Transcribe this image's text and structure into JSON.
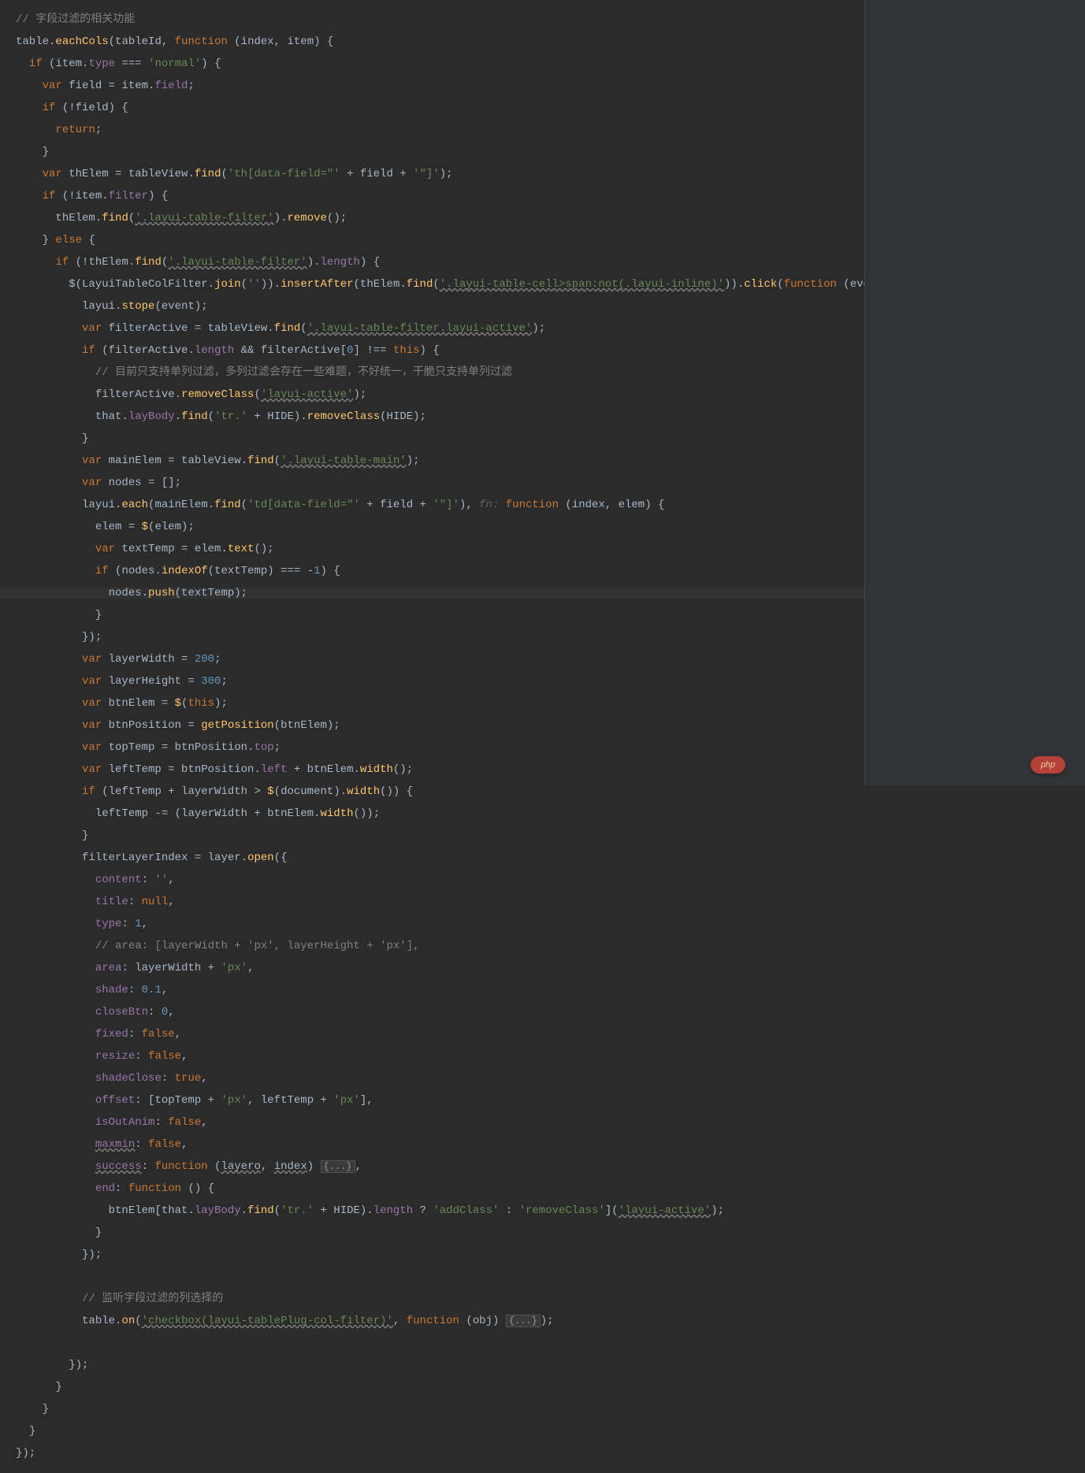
{
  "lines": {
    "l1_comment": "// 字段过滤的相关功能",
    "l2_a": "table.",
    "l2_b": "eachCols",
    "l2_c": "(tableId, ",
    "l2_d": "function",
    "l2_e": " (index, item) {",
    "l3_a": "if",
    "l3_b": " (item.",
    "l3_c": "type",
    "l3_d": " === ",
    "l3_e": "'normal'",
    "l3_f": ") {",
    "l4_a": "var ",
    "l4_b": "field = item.",
    "l4_c": "field",
    "l4_d": ";",
    "l5_a": "if",
    "l5_b": " (!field) {",
    "l6_a": "return",
    "l6_b": ";",
    "l7": "}",
    "l8_a": "var ",
    "l8_b": "thElem = tableView.",
    "l8_c": "find",
    "l8_d": "(",
    "l8_e": "'th[data-field=\"'",
    "l8_f": " + field + ",
    "l8_g": "'\"]'",
    "l8_h": ");",
    "l9_a": "if",
    "l9_b": " (!item.",
    "l9_c": "filter",
    "l9_d": ") {",
    "l10_a": "thElem.",
    "l10_b": "find",
    "l10_c": "(",
    "l10_d": "'.layui-table-filter'",
    "l10_e": ").",
    "l10_f": "remove",
    "l10_g": "();",
    "l11_a": "} ",
    "l11_b": "else",
    "l11_c": " {",
    "l12_a": "if",
    "l12_b": " (!thElem.",
    "l12_c": "find",
    "l12_d": "(",
    "l12_e": "'.layui-table-filter'",
    "l12_f": ").",
    "l12_g": "length",
    "l12_h": ") {",
    "l13_a": "$(LayuiTableColFilter.",
    "l13_b": "join",
    "l13_c": "(",
    "l13_d": "''",
    "l13_e": ")).",
    "l13_f": "insertAfter",
    "l13_g": "(thElem.",
    "l13_h": "find",
    "l13_i": "(",
    "l13_j": "'.layui-table-cell>span:not(.layui-inline)'",
    "l13_k": ")).",
    "l13_l": "click",
    "l13_m": "(",
    "l13_n": "function",
    "l13_o": " (event) {",
    "l14_a": "layui.",
    "l14_b": "stope",
    "l14_c": "(event);",
    "l15_a": "var ",
    "l15_b": "filterActive = tableView.",
    "l15_c": "find",
    "l15_d": "(",
    "l15_e": "'.layui-table-filter.layui-active'",
    "l15_f": ");",
    "l16_a": "if",
    "l16_b": " (filterActive.",
    "l16_c": "length",
    "l16_d": " && filterActive[",
    "l16_e": "0",
    "l16_f": "] !== ",
    "l16_g": "this",
    "l16_h": ") {",
    "l17": "// 目前只支持单列过滤，多列过滤会存在一些难题，不好统一，干脆只支持单列过滤",
    "l18_a": "filterActive.",
    "l18_b": "removeClass",
    "l18_c": "(",
    "l18_d": "'layui-active'",
    "l18_e": ");",
    "l19_a": "that.",
    "l19_b": "layBody",
    "l19_c": ".",
    "l19_d": "find",
    "l19_e": "(",
    "l19_f": "'tr.'",
    "l19_g": " + HIDE).",
    "l19_h": "removeClass",
    "l19_i": "(HIDE);",
    "l20": "}",
    "l21_a": "var ",
    "l21_b": "mainElem = tableView.",
    "l21_c": "find",
    "l21_d": "(",
    "l21_e": "'.layui-table-main'",
    "l21_f": ");",
    "l22_a": "var ",
    "l22_b": "nodes = [];",
    "l23_a": "layui.",
    "l23_b": "each",
    "l23_c": "(mainElem.",
    "l23_d": "find",
    "l23_e": "(",
    "l23_f": "'td[data-field=\"'",
    "l23_g": " + field + ",
    "l23_h": "'\"]'",
    "l23_i": "), ",
    "l23_hint": "fn: ",
    "l23_j": "function",
    "l23_k": " (index, elem) {",
    "l24_a": "elem = ",
    "l24_b": "$",
    "l24_c": "(elem);",
    "l25_a": "var ",
    "l25_b": "textTemp = elem.",
    "l25_c": "text",
    "l25_d": "();",
    "l26_a": "if",
    "l26_b": " (nodes.",
    "l26_c": "indexOf",
    "l26_d": "(textTemp) === -",
    "l26_e": "1",
    "l26_f": ") {",
    "l27_a": "nodes.",
    "l27_b": "push",
    "l27_c": "(textTemp);",
    "l28": "}",
    "l29": "});",
    "l30_a": "var ",
    "l30_b": "layerWidth = ",
    "l30_c": "200",
    "l30_d": ";",
    "l31_a": "var ",
    "l31_b": "layerHeight = ",
    "l31_c": "300",
    "l31_d": ";",
    "l32_a": "var ",
    "l32_b": "btnElem = ",
    "l32_c": "$",
    "l32_d": "(",
    "l32_e": "this",
    "l32_f": ");",
    "l33_a": "var ",
    "l33_b": "btnPosition = ",
    "l33_c": "getPosition",
    "l33_d": "(btnElem);",
    "l34_a": "var ",
    "l34_b": "topTemp = btnPosition.",
    "l34_c": "top",
    "l34_d": ";",
    "l35_a": "var ",
    "l35_b": "leftTemp = btnPosition.",
    "l35_c": "left",
    "l35_d": " + btnElem.",
    "l35_e": "width",
    "l35_f": "();",
    "l36_a": "if",
    "l36_b": " (leftTemp + layerWidth > ",
    "l36_c": "$",
    "l36_d": "(document).",
    "l36_e": "width",
    "l36_f": "()) {",
    "l37": "leftTemp -= (layerWidth + btnElem.",
    "l37_b": "width",
    "l37_c": "());",
    "l38": "}",
    "l39_a": "filterLayerIndex = layer.",
    "l39_b": "open",
    "l39_c": "({",
    "l40_a": "content",
    "l40_b": ": ",
    "l40_c": "''",
    "l40_d": ",",
    "l41_a": "title",
    "l41_b": ": ",
    "l41_c": "null",
    "l41_d": ",",
    "l42_a": "type",
    "l42_b": ": ",
    "l42_c": "1",
    "l42_d": ",",
    "l43": "// area: [layerWidth + 'px', layerHeight + 'px'],",
    "l44_a": "area",
    "l44_b": ": layerWidth + ",
    "l44_c": "'px'",
    "l44_d": ",",
    "l45_a": "shade",
    "l45_b": ": ",
    "l45_c": "0.1",
    "l45_d": ",",
    "l46_a": "closeBtn",
    "l46_b": ": ",
    "l46_c": "0",
    "l46_d": ",",
    "l47_a": "fixed",
    "l47_b": ": ",
    "l47_c": "false",
    "l47_d": ",",
    "l48_a": "resize",
    "l48_b": ": ",
    "l48_c": "false",
    "l48_d": ",",
    "l49_a": "shadeClose",
    "l49_b": ": ",
    "l49_c": "true",
    "l49_d": ",",
    "l50_a": "offset",
    "l50_b": ": [topTemp + ",
    "l50_c": "'px'",
    "l50_d": ", leftTemp + ",
    "l50_e": "'px'",
    "l50_f": "],",
    "l51_a": "isOutAnim",
    "l51_b": ": ",
    "l51_c": "false",
    "l51_d": ",",
    "l52_a": "maxmin",
    "l52_b": ": ",
    "l52_c": "false",
    "l52_d": ",",
    "l53_a": "success",
    "l53_b": ": ",
    "l53_c": "function",
    "l53_d": " (",
    "l53_e": "layero",
    "l53_f": ", ",
    "l53_g": "index",
    "l53_h": ") ",
    "l53_i": "{...}",
    "l53_j": ",",
    "l54_a": "end",
    "l54_b": ": ",
    "l54_c": "function",
    "l54_d": " () {",
    "l55_a": "btnElem[that.",
    "l55_b": "layBody",
    "l55_c": ".",
    "l55_d": "find",
    "l55_e": "(",
    "l55_f": "'tr.'",
    "l55_g": " + HIDE).",
    "l55_h": "length",
    "l55_i": " ? ",
    "l55_j": "'addClass'",
    "l55_k": " : ",
    "l55_l": "'removeClass'",
    "l55_m": "](",
    "l55_n": "'layui-active'",
    "l55_o": ");",
    "l56": "}",
    "l57": "});",
    "l58": "",
    "l59": "// 监听字段过滤的列选择的",
    "l60_a": "table.",
    "l60_b": "on",
    "l60_c": "(",
    "l60_d": "'checkbox(layui-tablePlug-col-filter)'",
    "l60_e": ", ",
    "l60_f": "function",
    "l60_g": " (obj) ",
    "l60_h": "{...}",
    "l60_i": ");",
    "l61": "",
    "l62": "});",
    "l63": "}",
    "l64": "}",
    "l65": "}",
    "l66": "});"
  },
  "logo": "php"
}
